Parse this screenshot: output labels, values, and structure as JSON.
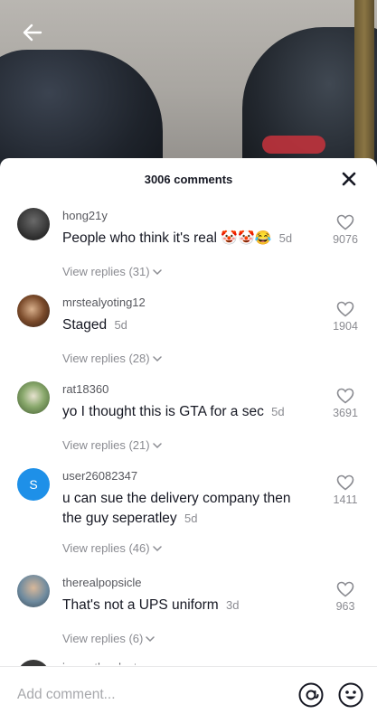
{
  "header": {
    "comment_count": "3006 comments"
  },
  "comments": [
    {
      "username": "hong21y",
      "text": "People who think it's real",
      "emojis": "🤡🤡😂",
      "time": "5d",
      "likes": "9076",
      "replies": "View replies (31)"
    },
    {
      "username": "mrstealyoting12",
      "text": "Staged",
      "time": "5d",
      "likes": "1904",
      "replies": "View replies (28)"
    },
    {
      "username": "rat18360",
      "text": "yo I thought this is GTA for a sec",
      "time": "5d",
      "likes": "3691",
      "replies": "View replies (21)"
    },
    {
      "username": "user26082347",
      "avatar_letter": "S",
      "text": "u can sue the delivery company then the guy seperatley",
      "time": "5d",
      "likes": "1411",
      "replies": "View replies (46)"
    },
    {
      "username": "therealpopsicle",
      "text": "That's not a UPS uniform",
      "time": "3d",
      "likes": "963",
      "replies": "View replies (6)"
    }
  ],
  "partial_comment": {
    "username": "imanotherdestroyer"
  },
  "input": {
    "placeholder": "Add comment..."
  },
  "icons": {
    "back": "back-arrow-icon",
    "close": "close-icon",
    "like": "heart-outline-icon",
    "chevron": "chevron-down-icon",
    "mention": "at-sign-icon",
    "emoji": "emoji-smile-icon"
  },
  "colors": {
    "text_primary": "#161823",
    "text_secondary": "#8a8b91",
    "avatar_letter_bg": "#1e90e8"
  }
}
